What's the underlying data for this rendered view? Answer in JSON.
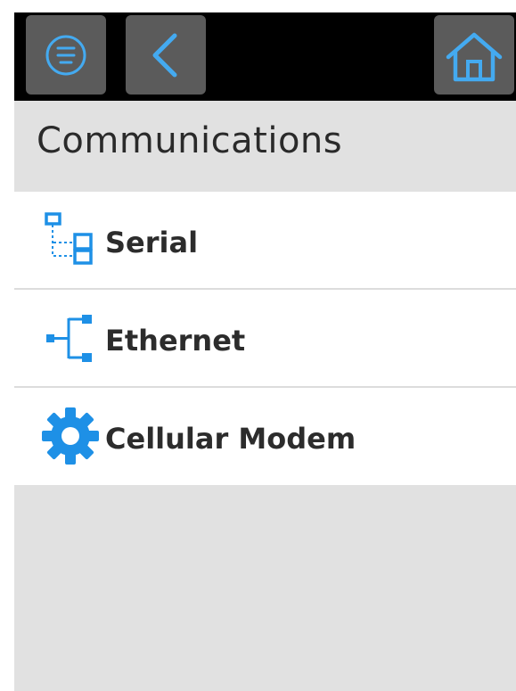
{
  "header": {
    "menu_icon": "menu-icon",
    "back_icon": "chevron-left-icon",
    "home_icon": "home-icon",
    "icon_color": "#44aaf0",
    "button_color": "#5b5b5b"
  },
  "title": "Communications",
  "items": [
    {
      "label": "Serial",
      "icon": "serial-icon"
    },
    {
      "label": "Ethernet",
      "icon": "ethernet-icon"
    },
    {
      "label": "Cellular Modem",
      "icon": "gear-icon"
    }
  ],
  "colors": {
    "accent": "#1e90e6",
    "background": "#e1e1e1",
    "topbar": "#000000"
  }
}
